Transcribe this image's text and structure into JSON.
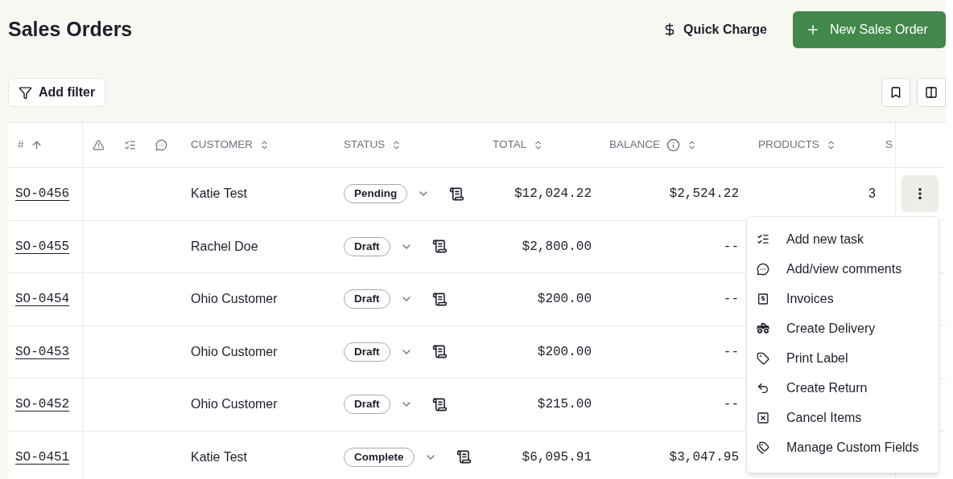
{
  "header": {
    "title": "Sales Orders",
    "quick_charge": "Quick Charge",
    "new_order": "New Sales Order"
  },
  "filter": {
    "label": "Add filter"
  },
  "table": {
    "columns": [
      {
        "label": "#",
        "sorted": true
      },
      {
        "label": "CUSTOMER",
        "sorted": false
      },
      {
        "label": "STATUS",
        "sorted": false
      },
      {
        "label": "TOTAL",
        "sorted": false
      },
      {
        "label": "BALANCE",
        "sorted": false,
        "info": true
      },
      {
        "label": "PRODUCTS",
        "sorted": false
      },
      {
        "label": "S"
      }
    ],
    "rows": [
      {
        "number": "SO-0456",
        "customer": "Katie Test",
        "status": "Pending",
        "total": "$12,024.22",
        "balance": "$2,524.22",
        "products": "3",
        "actions": {
          "menu_open": true
        }
      },
      {
        "number": "SO-0455",
        "customer": "Rachel Doe",
        "status": "Draft",
        "total": "$2,800.00",
        "balance": "--"
      },
      {
        "number": "SO-0454",
        "customer": "Ohio Customer",
        "status": "Draft",
        "total": "$200.00",
        "balance": "--"
      },
      {
        "number": "SO-0453",
        "customer": "Ohio Customer",
        "status": "Draft",
        "total": "$200.00",
        "balance": "--"
      },
      {
        "number": "SO-0452",
        "customer": "Ohio Customer",
        "status": "Draft",
        "total": "$215.00",
        "balance": "--"
      },
      {
        "number": "SO-0451",
        "customer": "Katie Test",
        "status": "Complete",
        "total": "$6,095.91",
        "balance": "$3,047.95"
      }
    ]
  },
  "menu": {
    "items": [
      {
        "kind": "task",
        "label": "Add new task"
      },
      {
        "kind": "comments",
        "label": "Add/view comments"
      },
      {
        "kind": "invoice",
        "label": "Invoices"
      },
      {
        "kind": "delivery",
        "label": "Create Delivery"
      },
      {
        "kind": "label",
        "label": "Print Label"
      },
      {
        "kind": "return",
        "label": "Create Return"
      },
      {
        "kind": "cancel",
        "label": "Cancel Items"
      },
      {
        "kind": "fields",
        "label": "Manage Custom Fields"
      }
    ]
  }
}
